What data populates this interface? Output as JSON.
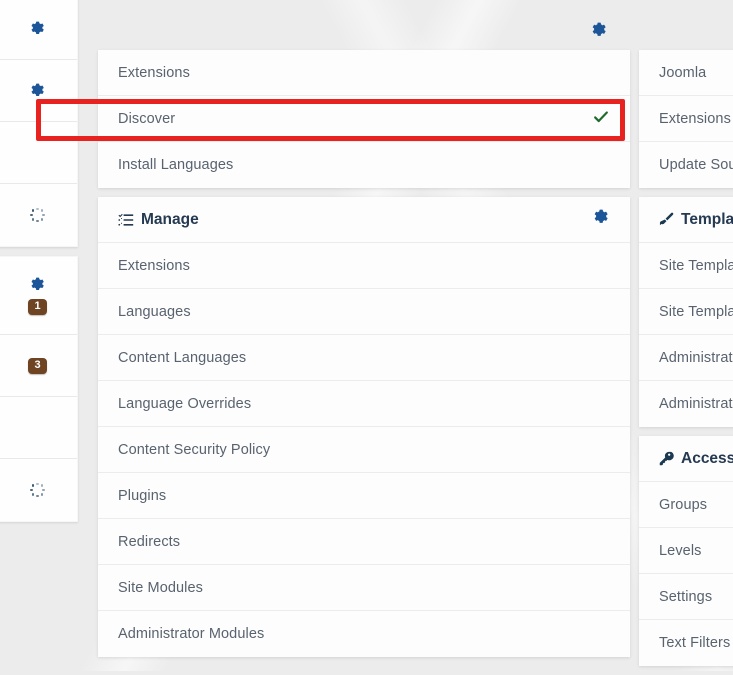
{
  "app": {
    "background_color": "#ececec",
    "panel_color": "#fdfdfd",
    "link_color": "#59636f",
    "heading_color": "#253a52",
    "accent_icon_color": "#1c5598",
    "badge_color": "#6f4422",
    "check_color": "#1d6b2d",
    "highlight_color": "#e8231f"
  },
  "left_rail": {
    "blocks": [
      {
        "rows": [
          {
            "icon": "gear-icon",
            "badge": null
          },
          {
            "icon": "gear-icon",
            "badge": null
          },
          {
            "icon": null,
            "badge": null
          },
          {
            "icon": "spinner-icon",
            "badge": null
          }
        ]
      },
      {
        "rows": [
          {
            "icon": "gear-icon",
            "badge": "1"
          },
          {
            "icon": null,
            "badge": "3"
          },
          {
            "icon": null,
            "badge": null
          },
          {
            "icon": "spinner-icon",
            "badge": null
          }
        ]
      }
    ]
  },
  "top_gear": {
    "icon": "gear-icon"
  },
  "middle_column": {
    "panels": [
      {
        "header": null,
        "items": [
          {
            "label": "Extensions",
            "check": false,
            "gear": false
          },
          {
            "label": "Discover",
            "check": true,
            "gear": false
          },
          {
            "label": "Install Languages",
            "check": false,
            "gear": false
          }
        ]
      },
      {
        "header": {
          "label": "Manage",
          "icon": "task-list-icon",
          "gear": true
        },
        "items": [
          {
            "label": "Extensions",
            "check": false,
            "gear": false
          },
          {
            "label": "Languages",
            "check": false,
            "gear": false
          },
          {
            "label": "Content Languages",
            "check": false,
            "gear": false
          },
          {
            "label": "Language Overrides",
            "check": false,
            "gear": false
          },
          {
            "label": "Content Security Policy",
            "check": false,
            "gear": false
          },
          {
            "label": "Plugins",
            "check": false,
            "gear": false
          },
          {
            "label": "Redirects",
            "check": false,
            "gear": false
          },
          {
            "label": "Site Modules",
            "check": false,
            "gear": false
          },
          {
            "label": "Administrator Modules",
            "check": false,
            "gear": false
          }
        ]
      }
    ]
  },
  "right_column": {
    "panels": [
      {
        "header": null,
        "items": [
          {
            "label": "Joomla"
          },
          {
            "label": "Extensions"
          },
          {
            "label": "Update Sources"
          }
        ]
      },
      {
        "header": {
          "label": "Templates",
          "icon": "paint-brush-icon"
        },
        "items": [
          {
            "label": "Site Templates"
          },
          {
            "label": "Site Template Styles"
          },
          {
            "label": "Administrator Templates"
          },
          {
            "label": "Administrator Template Styles"
          }
        ]
      },
      {
        "header": {
          "label": "Access",
          "icon": "key-icon"
        },
        "items": [
          {
            "label": "Groups"
          },
          {
            "label": "Levels"
          },
          {
            "label": "Settings"
          },
          {
            "label": "Text Filters"
          }
        ]
      }
    ]
  },
  "annotation": {
    "type": "red-rectangle-highlight",
    "target_label": "Discover"
  }
}
